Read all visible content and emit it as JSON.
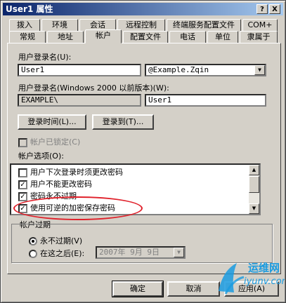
{
  "window": {
    "title": "User1 属性"
  },
  "titlebar_buttons": {
    "help": "?",
    "close": "X"
  },
  "tabs_row1": [
    "拨入",
    "环境",
    "会话",
    "远程控制",
    "终端服务配置文件",
    "COM+"
  ],
  "tabs_row2": [
    "常规",
    "地址",
    "帐户",
    "配置文件",
    "电话",
    "单位",
    "隶属于"
  ],
  "account": {
    "logon_name_label": "用户登录名(U):",
    "logon_name_value": "User1",
    "domain_value": "@Example.Zqin",
    "pre2000_label": "用户登录名(Windows 2000 以前版本)(W):",
    "pre2000_domain": "EXAMPLE\\",
    "pre2000_value": "User1",
    "logon_hours_btn": "登录时间(L)...",
    "logon_to_btn": "登录到(T)...",
    "locked_label": "帐户已锁定(C)",
    "options_label": "帐户选项(O):",
    "options": [
      {
        "label": "用户下次登录时须更改密码",
        "checked": false
      },
      {
        "label": "用户不能更改密码",
        "checked": true
      },
      {
        "label": "密码永不过期",
        "checked": true
      },
      {
        "label": "使用可逆的加密保存密码",
        "checked": true
      }
    ],
    "expires_group": "帐户过期",
    "never_label": "永不过期(V)",
    "end_of_label": "在这之后(E):",
    "end_date": "2007年 9月 9日"
  },
  "footer": {
    "ok": "确定",
    "cancel": "取消",
    "apply": "应用(A)"
  },
  "watermark": {
    "line1": "运维网",
    "line2": "iyunv.com"
  },
  "colors": {
    "title_start": "#0a246a",
    "title_end": "#a6caf0",
    "highlight": "#e0202a"
  }
}
